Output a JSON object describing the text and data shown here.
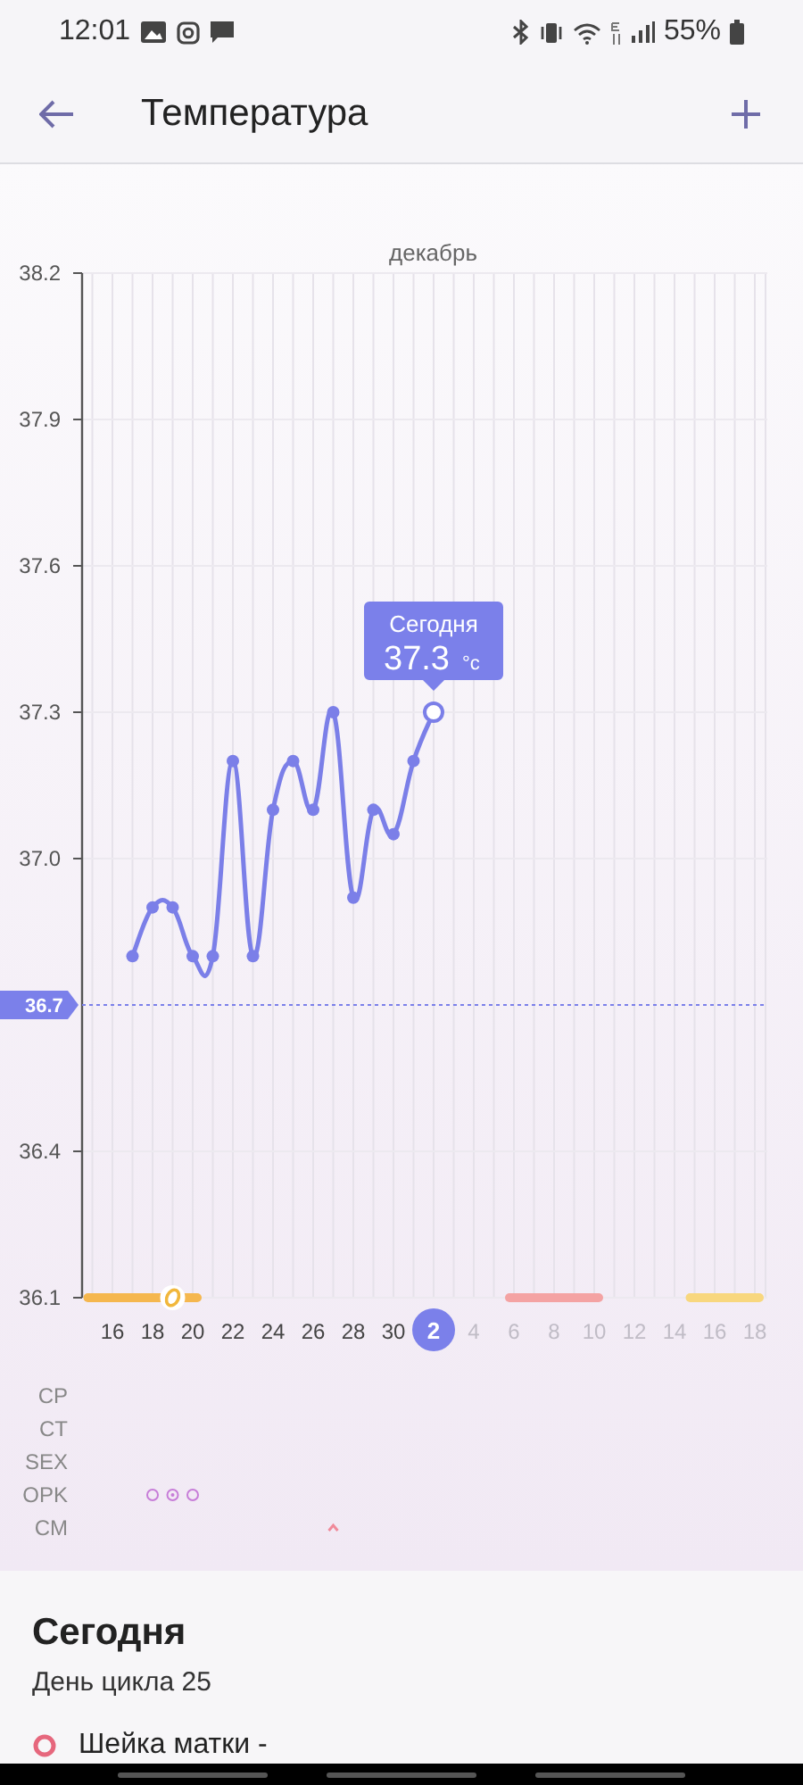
{
  "status_bar": {
    "time": "12:01",
    "battery": "55%"
  },
  "header": {
    "title": "Температура"
  },
  "chart": {
    "month_label": "декабрь",
    "chart_data": {
      "type": "line",
      "grid": true,
      "categories": [
        null,
        "16",
        null,
        "18",
        null,
        "20",
        null,
        "22",
        null,
        "24",
        null,
        "26",
        null,
        "28",
        null,
        "30",
        null,
        "2",
        null,
        "4",
        null,
        "6",
        null,
        "8",
        null,
        "10",
        null,
        "12",
        null,
        "14",
        null,
        "16",
        null,
        "18"
      ],
      "series": [
        {
          "color": "#7b7fe8",
          "marker": true,
          "values": [
            null,
            null,
            36.8,
            36.9,
            36.9,
            36.8,
            36.8,
            37.2,
            36.8,
            37.1,
            37.2,
            37.1,
            37.3,
            36.92,
            37.1,
            37.05,
            37.2,
            37.3,
            null,
            null,
            null,
            null,
            null,
            null,
            null,
            null,
            null,
            null,
            null,
            null,
            null,
            null,
            null,
            null
          ]
        }
      ],
      "ylim": [
        36.1,
        38.2
      ],
      "yticks": [
        {
          "value": 36.1,
          "label": "36.1"
        },
        {
          "value": 36.4,
          "label": "36.4"
        },
        {
          "value": 37.0,
          "label": "37.0"
        },
        {
          "value": 37.3,
          "label": "37.3"
        },
        {
          "value": 37.6,
          "label": "37.6"
        },
        {
          "value": 37.9,
          "label": "37.9"
        },
        {
          "value": 38.2,
          "label": "38.2"
        }
      ],
      "ref_lines": [
        {
          "axis": "y",
          "value": 36.7,
          "label": "36.7"
        }
      ]
    },
    "cycle_bands": [
      {
        "color": "#f5b74e"
      },
      {
        "color": "#f4a3a3"
      },
      {
        "color": "#f8d77e"
      }
    ],
    "tooltip": {
      "title": "Сегодня",
      "value": "37.3",
      "unit": "°c"
    },
    "ovulation_marker": true,
    "symptom_rows": [
      {
        "label": "CP"
      },
      {
        "label": "CT"
      },
      {
        "label": "SEX"
      },
      {
        "label": "OPK",
        "marks": [
          {
            "kind": "ring"
          },
          {
            "kind": "dot_ring"
          },
          {
            "kind": "ring"
          }
        ]
      },
      {
        "label": "CM",
        "marks": [
          {
            "kind": "caret"
          }
        ]
      }
    ]
  },
  "today": {
    "title": "Сегодня",
    "subtitle": "День цикла 25",
    "items": [
      {
        "label": "Шейка матки -"
      }
    ]
  }
}
